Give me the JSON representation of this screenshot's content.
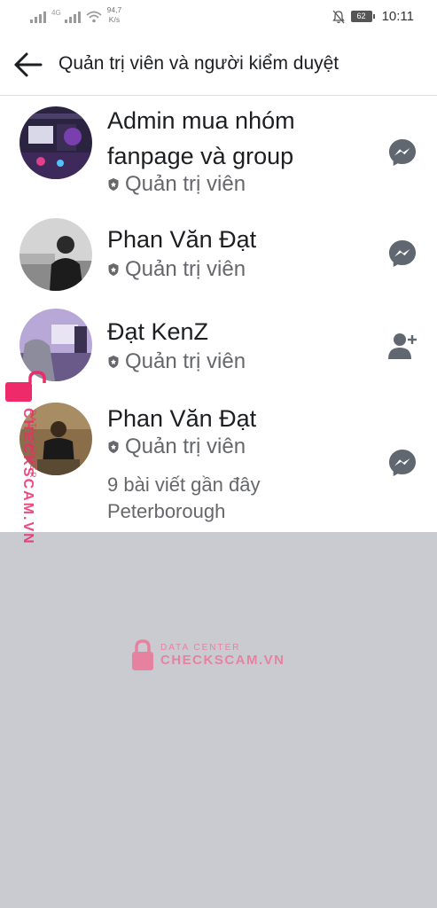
{
  "status_bar": {
    "signal_label": "4G",
    "speed_value": "94,7",
    "speed_unit": "K/s",
    "battery": "62",
    "time": "10:11"
  },
  "header": {
    "title": "Quản trị viên và người kiểm duyệt"
  },
  "members": [
    {
      "name": "Admin mua nhóm fanpage và group",
      "role": "Quản trị viên",
      "action_icon": "messenger-icon"
    },
    {
      "name": "Phan Văn Đạt",
      "role": "Quản trị viên",
      "action_icon": "messenger-icon"
    },
    {
      "name": "Đạt KenZ",
      "role": "Quản trị viên",
      "action_icon": "add-friend-icon"
    },
    {
      "name": "Phan Văn Đạt",
      "role": "Quản trị viên",
      "recent_posts": "9 bài viết gần đây",
      "location": "Peterborough",
      "action_icon": "messenger-icon"
    }
  ],
  "watermark": {
    "small": "DATA CENTER",
    "big": "CHECKSCAM.VN"
  },
  "colors": {
    "text_primary": "#1c1e21",
    "text_secondary": "#65676b",
    "overlay": "#c9cbd0",
    "watermark": "#ee2a6a"
  }
}
